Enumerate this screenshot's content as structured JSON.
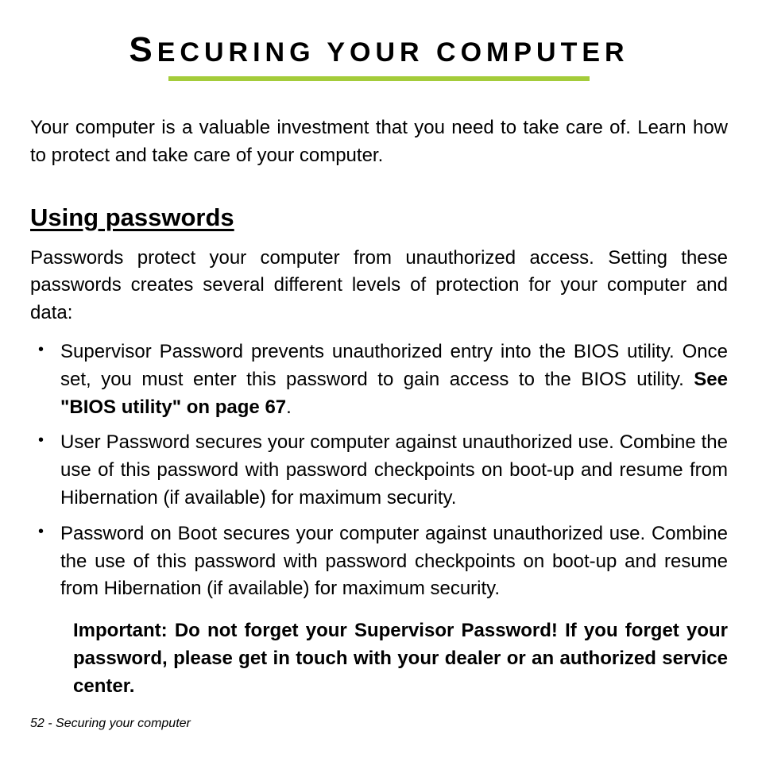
{
  "title": {
    "leading_cap": "S",
    "rest_upper": "ECURING YOUR COMPUTER"
  },
  "intro": "Your computer is a valuable investment that you need to take care of. Learn how to protect and take care of your computer.",
  "section": {
    "heading": "Using passwords",
    "intro": "Passwords protect your computer from unauthorized access. Setting these passwords creates several different levels of protection for your computer and data:",
    "bullets": [
      {
        "text_before": "Supervisor Password prevents unauthorized entry into the BIOS utility. Once set, you must enter this password to gain access to the BIOS utility. ",
        "xref": "See \"BIOS utility\" on page 67",
        "text_after": "."
      },
      {
        "text_before": "User Password secures your computer against unauthorized use. Combine the use of this password with password checkpoints on boot-up and resume from Hibernation (if available) for maximum security.",
        "xref": "",
        "text_after": ""
      },
      {
        "text_before": "Password on Boot secures your computer against unauthorized use. Combine the use of this password with password checkpoints on boot-up and resume from Hibernation (if available) for maximum security.",
        "xref": "",
        "text_after": ""
      }
    ],
    "important": "Important: Do not forget your Supervisor Password! If you forget your password, please get in touch with your dealer or an authorized service center."
  },
  "footer": "52 - Securing your computer"
}
